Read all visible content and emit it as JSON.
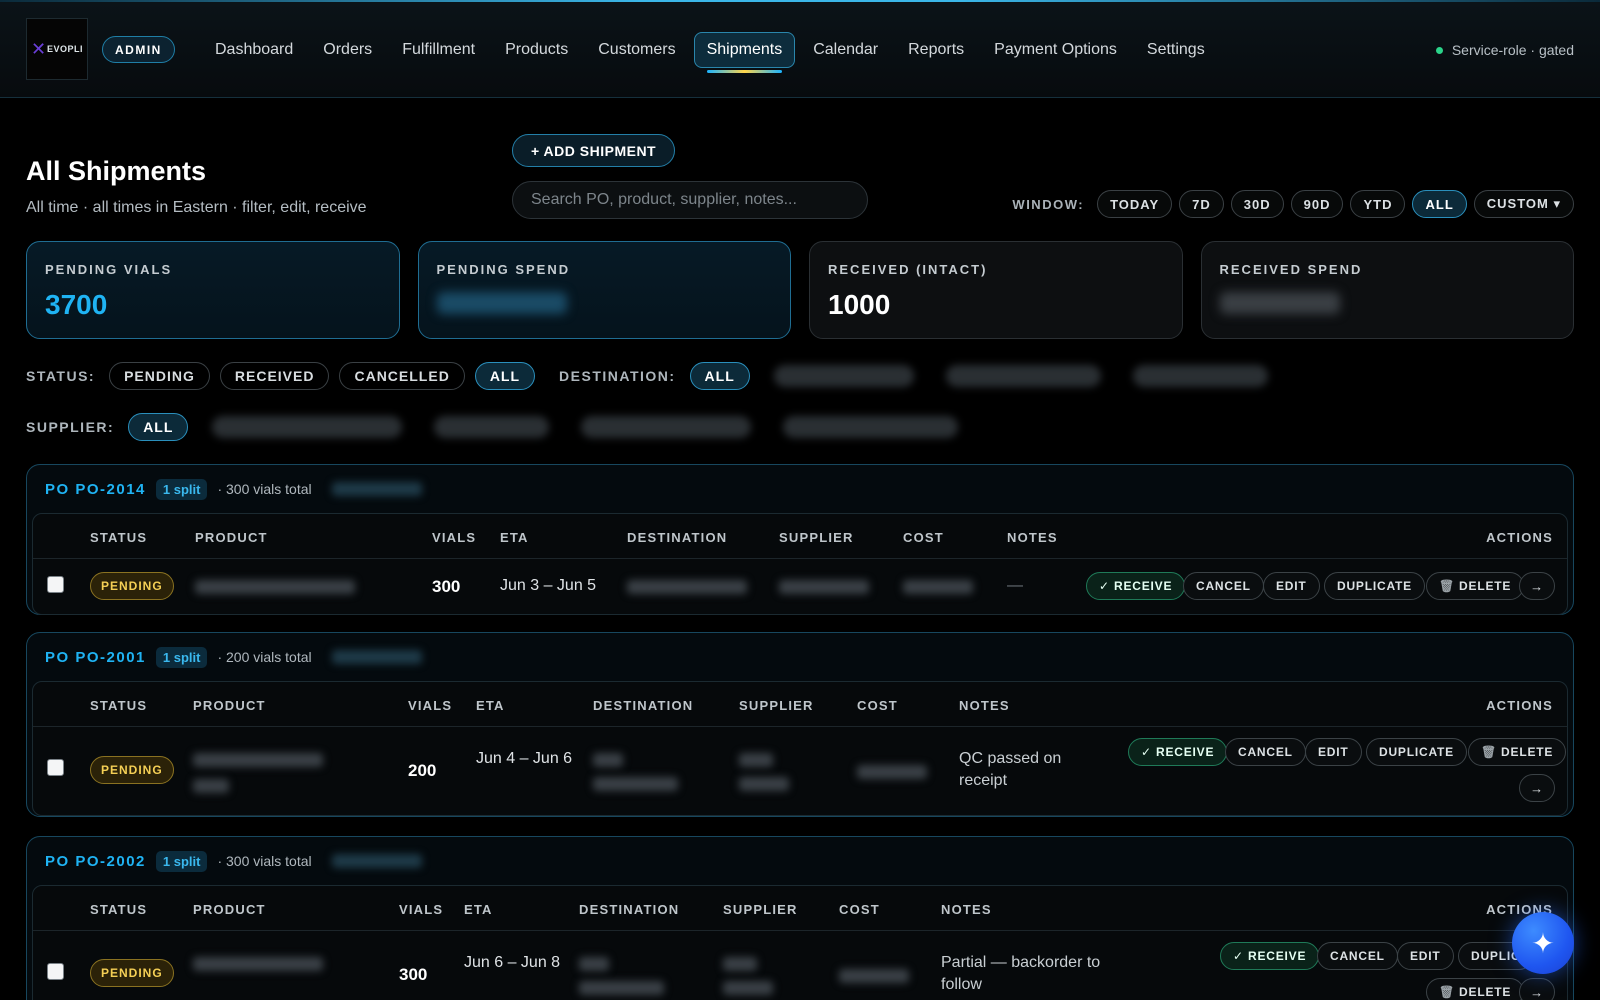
{
  "brand": {
    "logo_text": "EVOPLI",
    "admin_badge": "ADMIN"
  },
  "nav": {
    "items": [
      "Dashboard",
      "Orders",
      "Fulfillment",
      "Products",
      "Customers",
      "Shipments",
      "Calendar",
      "Reports",
      "Payment Options",
      "Settings"
    ],
    "active": "Shipments",
    "service_status": "Service-role · gated"
  },
  "header": {
    "title": "All Shipments",
    "subtitle": "All time · all times in Eastern · filter, edit, receive",
    "add_button": "+ ADD SHIPMENT",
    "search_placeholder": "Search PO, product, supplier, notes..."
  },
  "window": {
    "label": "WINDOW:",
    "options": [
      "TODAY",
      "7D",
      "30D",
      "90D",
      "YTD",
      "ALL",
      "CUSTOM ▾"
    ],
    "active": "ALL"
  },
  "stats": [
    {
      "label": "PENDING VIALS",
      "value": "3700"
    },
    {
      "label": "PENDING SPEND",
      "value": ""
    },
    {
      "label": "RECEIVED (INTACT)",
      "value": "1000"
    },
    {
      "label": "RECEIVED SPEND",
      "value": ""
    }
  ],
  "filters": {
    "status_label": "STATUS:",
    "status_options": [
      "PENDING",
      "RECEIVED",
      "CANCELLED",
      "ALL"
    ],
    "destination_label": "DESTINATION:",
    "destination_all": "ALL",
    "supplier_label": "SUPPLIER:",
    "supplier_all": "ALL"
  },
  "columns": {
    "status": "STATUS",
    "product": "PRODUCT",
    "vials": "VIALS",
    "eta": "ETA",
    "destination": "DESTINATION",
    "supplier": "SUPPLIER",
    "cost": "COST",
    "notes": "NOTES",
    "actions": "ACTIONS"
  },
  "actions": {
    "receive": "✓ RECEIVE",
    "cancel": "CANCEL",
    "edit": "EDIT",
    "duplicate": "DUPLICATE",
    "duplicate_cut": "DUPLIC",
    "delete": "DELETE",
    "arrow": "→",
    "trash": "🗑"
  },
  "purchase_orders": [
    {
      "id": "PO PO-2014",
      "split": "1 split",
      "meta": "· 300 vials total",
      "row": {
        "status": "PENDING",
        "vials": "300",
        "eta": "Jun 3 – Jun 5",
        "notes": "—"
      }
    },
    {
      "id": "PO PO-2001",
      "split": "1 split",
      "meta": "· 200 vials total",
      "row": {
        "status": "PENDING",
        "vials": "200",
        "eta": "Jun 4 – Jun 6",
        "notes": "QC passed on receipt"
      }
    },
    {
      "id": "PO PO-2002",
      "split": "1 split",
      "meta": "· 300 vials total",
      "row": {
        "status": "PENDING",
        "vials": "300",
        "eta": "Jun 6 – Jun 8",
        "notes": "Partial — backorder to follow"
      }
    }
  ],
  "colors": {
    "accent": "#1fb3f3",
    "pending": "#f4cf55",
    "receive": "#1f7a58",
    "fab": "#1f56f0"
  },
  "fab_icon": "sparkle-icon"
}
